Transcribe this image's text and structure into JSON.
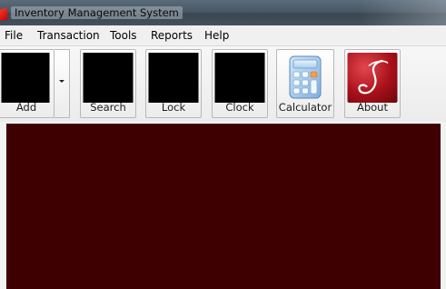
{
  "window": {
    "title": "Inventory Management System"
  },
  "menu": {
    "items": [
      "File",
      "Transaction",
      "Tools",
      "Reports",
      "Help"
    ]
  },
  "toolbar": {
    "buttons": [
      {
        "label": "Add",
        "icon": "black-image-icon"
      },
      {
        "label": "Search",
        "icon": "black-image-icon"
      },
      {
        "label": "Lock",
        "icon": "black-image-icon"
      },
      {
        "label": "Clock",
        "icon": "black-image-icon"
      },
      {
        "label": "Calculator",
        "icon": "calculator-icon"
      },
      {
        "label": "About",
        "icon": "script-j-logo-icon"
      }
    ]
  },
  "colors": {
    "workspace_bg": "#3e0000",
    "toolbar_bg": "#f0f0f0",
    "about_red": "#a9111a"
  }
}
